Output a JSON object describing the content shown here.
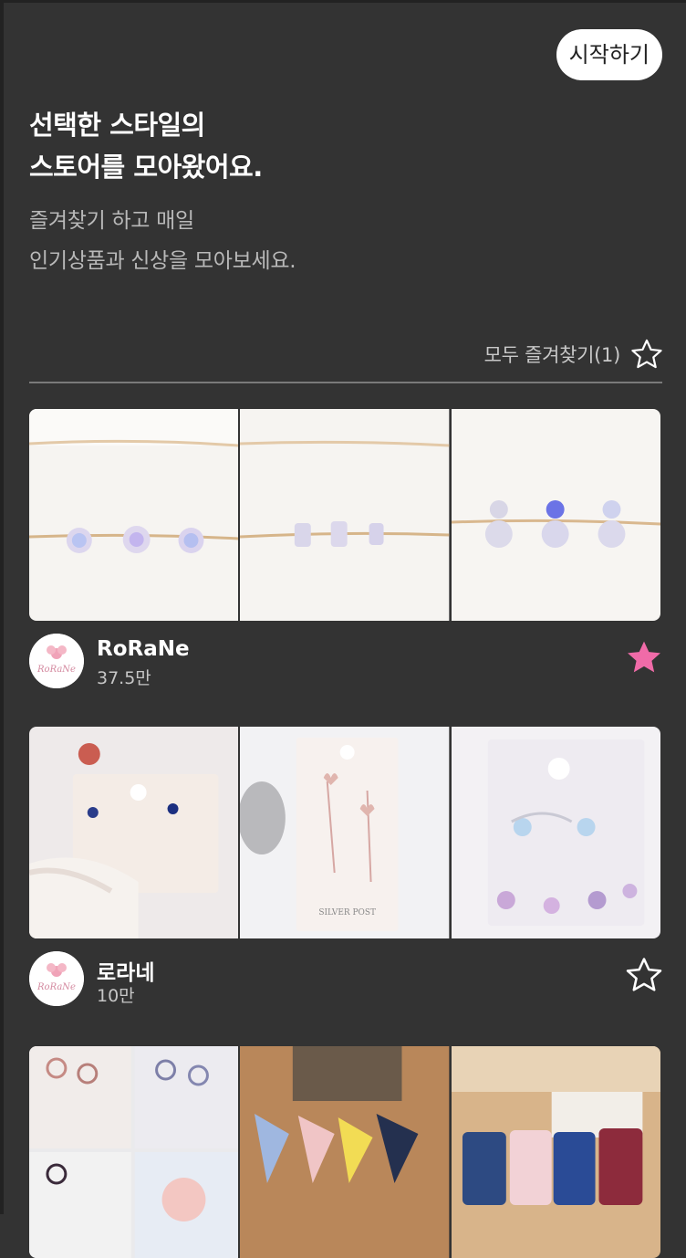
{
  "header": {
    "start_label": "시작하기"
  },
  "headline": {
    "line1": "선택한 스타일의",
    "line2": "스토어를 모아왔어요."
  },
  "subtext": {
    "line1": "즐겨찾기 하고 매일",
    "line2": "인기상품과 신상을 모아보세요."
  },
  "fav_all": {
    "label": "모두 즐겨찾기(1)",
    "icon": "star-outline-icon"
  },
  "colors": {
    "background": "#333333",
    "favorite_active": "#f06ba8",
    "favorite_inactive": "#ffffff"
  },
  "stores": [
    {
      "name": "RoRaNe",
      "count": "37.5만",
      "favorited": true,
      "logo_text": "RoRaNe"
    },
    {
      "name": "로라네",
      "count": "10만",
      "favorited": false,
      "logo_text": "RoRaNe"
    },
    {
      "name": "",
      "count": "",
      "favorited": false
    }
  ],
  "product_card_text": {
    "silver_post": "SILVER POST"
  }
}
